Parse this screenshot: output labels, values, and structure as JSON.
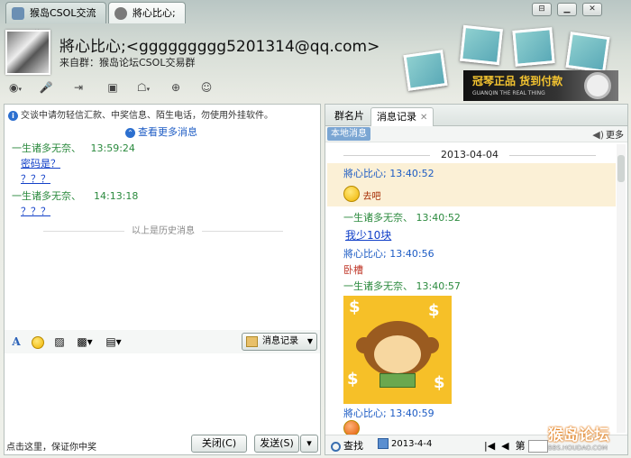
{
  "tabs": [
    {
      "label": "猴岛CSOL交流群"
    },
    {
      "label": "將心比心;"
    }
  ],
  "window": {
    "restore": "⊟",
    "minimize": "▁",
    "close": "✕"
  },
  "header": {
    "nickname": "將心比心;<ggggggggg5201314@qq.com>",
    "source": "来自群：猴岛论坛CSOL交易群"
  },
  "ad": {
    "text": "冠琴正品 货到付款",
    "sub": "GUANQIN THE REAL THING"
  },
  "left": {
    "notice": "交谈中请勿轻信汇款、中奖信息、陌生电话，勿使用外挂软件。",
    "more_messages": "查看更多消息",
    "messages": [
      {
        "sender": "一生诸多无奈、",
        "time": "13:59:24",
        "lines": [
          "密码是？",
          "？？？"
        ]
      },
      {
        "sender": "一生诸多无奈、",
        "time": "14:13:18",
        "lines": [
          "？？？"
        ]
      }
    ],
    "history_label": "以上是历史消息",
    "msg_record_button": "消息记录",
    "input_hint": "点击这里，保证你中奖",
    "close_button": "关闭(C)",
    "send_button": "发送(S)"
  },
  "right": {
    "tabs": [
      {
        "label": "群名片"
      },
      {
        "label": "消息记录"
      }
    ],
    "local_tag": "本地消息",
    "more": "更多",
    "date": "2013-04-04",
    "records": [
      {
        "sender": "將心比心;",
        "time": "13:40:52",
        "text": "去吧"
      },
      {
        "sender": "一生诸多无奈、",
        "time": "13:40:52",
        "text": "我少10块"
      },
      {
        "sender": "將心比心;",
        "time": "13:40:56",
        "text": "卧槽"
      },
      {
        "sender": "一生诸多无奈、",
        "time": "13:40:57"
      },
      {
        "sender": "將心比心;",
        "time": "13:40:59"
      }
    ],
    "search": "查找",
    "date_picker": "2013-4-4",
    "page_label": "第"
  },
  "watermark": {
    "text": "猴岛论坛",
    "sub": "BBS.HOUDAO.COM"
  }
}
